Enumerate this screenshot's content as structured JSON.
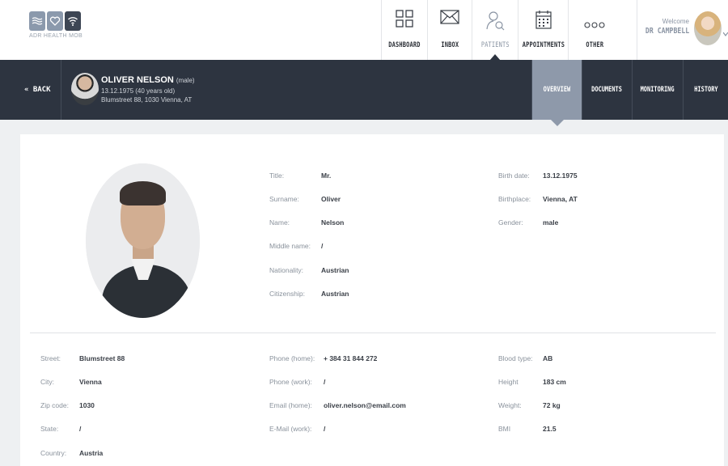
{
  "app": {
    "logo_text": "ADR HEALTH MOB"
  },
  "nav": {
    "items": [
      {
        "label": "DASHBOARD",
        "icon": "grid-icon"
      },
      {
        "label": "INBOX",
        "icon": "envelope-icon"
      },
      {
        "label": "PATIENTS",
        "icon": "patient-search-icon",
        "active": true
      },
      {
        "label": "APPOINTMENTS",
        "icon": "calendar-icon"
      },
      {
        "label": "OTHER",
        "icon": "more-icon"
      }
    ],
    "welcome_text": "Welcome",
    "user_name": "DR CAMPBELL"
  },
  "patient": {
    "back_label": "« BACK",
    "name": "OLIVER NELSON",
    "gender_tag": "(male)",
    "dob_line": "13.12.1975 (40 years old)",
    "address_line": "Blumstreet 88, 1030 Vienna, AT",
    "tabs": [
      {
        "label": "OVERVIEW",
        "active": true
      },
      {
        "label": "DOCUMENTS"
      },
      {
        "label": "MONITORING"
      },
      {
        "label": "HISTORY"
      }
    ]
  },
  "details": {
    "title_label": "Title:",
    "title_value": "Mr.",
    "surname_label": "Surname:",
    "surname_value": "Oliver",
    "name_label": "Name:",
    "name_value": "Nelson",
    "middle_label": "Middle name:",
    "middle_value": "/",
    "nationality_label": "Nationality:",
    "nationality_value": "Austrian",
    "citizenship_label": "Citizenship:",
    "citizenship_value": "Austrian",
    "birthdate_label": "Birth date:",
    "birthdate_value": "13.12.1975",
    "birthplace_label": "Birthplace:",
    "birthplace_value": "Vienna, AT",
    "gender_label": "Gender:",
    "gender_value": "male"
  },
  "contact": {
    "street_label": "Street:",
    "street_value": "Blumstreet 88",
    "city_label": "City:",
    "city_value": "Vienna",
    "zip_label": "Zip code:",
    "zip_value": "1030",
    "state_label": "State:",
    "state_value": "/",
    "country_label": "Country:",
    "country_value": "Austria",
    "phone_home_label": "Phone (home):",
    "phone_home_value": "+ 384 31 844 272",
    "phone_work_label": "Phone (work):",
    "phone_work_value": "/",
    "email_home_label": "Email (home):",
    "email_home_value": "oliver.nelson@email.com",
    "email_work_label": "E-Mail (work):",
    "email_work_value": "/",
    "blood_label": "Blood type:",
    "blood_value": "AB",
    "height_label": "Height",
    "height_value": "183 cm",
    "weight_label": "Weight:",
    "weight_value": "72 kg",
    "bmi_label": "BMI",
    "bmi_value": "21.5"
  }
}
